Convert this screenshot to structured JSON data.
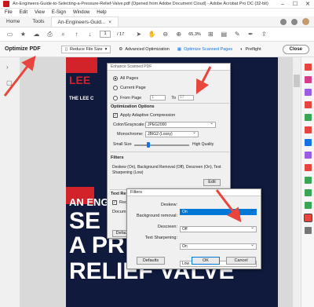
{
  "window": {
    "title": "An-Engineers-Guide-to-Selecting-a-Pressure-Relief-Valve.pdf (Opened from Adobe Document Cloud) - Adobe Acrobat Pro DC (32-bit)",
    "controls": [
      "–",
      "☐",
      "✕"
    ]
  },
  "menu": [
    "File",
    "Edit",
    "View",
    "E-Sign",
    "Window",
    "Help"
  ],
  "tabs": {
    "home": "Home",
    "tools": "Tools",
    "doc": "An-Engineers-Guid...",
    "doc_close": "×"
  },
  "toolbar": {
    "page_current": "1",
    "page_total": "/ 17",
    "zoom": "65.3%"
  },
  "optimize_bar": {
    "title": "Optimize PDF",
    "reduce": "Reduce File Size",
    "advanced": "Advanced Optimization",
    "enhance": "Optimize Scanned Pages",
    "preflight": "Preflight",
    "close": "Close"
  },
  "page_art": {
    "logo": "LEE",
    "tagline": "THE LEE C",
    "an_engineers": "AN ENGIN",
    "line1": "SE",
    "line2": "A PR",
    "line3": "RELIEF VALVE"
  },
  "enhance_dialog": {
    "title": "Enhance Scanned PDF",
    "all_pages": "All Pages",
    "current_page": "Current Page",
    "from_page": "From Page",
    "from_value": "1",
    "to_label": "To",
    "to_value": "17",
    "options_header": "Optimization Options",
    "adaptive": "Apply Adaptive Compression",
    "color_label": "Color/Grayscale:",
    "color_value": "JPEG2000",
    "mono_label": "Monochrome:",
    "mono_value": "JBIG2 (Lossy)",
    "small_size": "Small Size",
    "high_quality": "High Quality",
    "filters_header": "Filters",
    "filters_desc": "Deskew (On), Background Removal (Off), Descreen (On), Text Sharpening (Low)",
    "edit": "Edit",
    "text_rec_header": "Text Re",
    "rec_label": "Reco",
    "doc_label": "Docum",
    "defaults": "Defau"
  },
  "filters_dialog": {
    "title": "Filters",
    "deskew_label": "Deskew:",
    "deskew_value": "On",
    "bg_label": "Background removal:",
    "bg_value": "Off",
    "descreen_label": "Descreen:",
    "descreen_value": "On",
    "sharp_label": "Text Sharpening:",
    "sharp_value": "Low",
    "defaults": "Defaults",
    "ok": "OK",
    "cancel": "Cancel"
  },
  "colors": {
    "annotation_red": "#e8453c",
    "acrobat_red": "#c8161d",
    "link_blue": "#1473e6",
    "page_navy": "#0f1a3d",
    "selection_blue": "#0078d7"
  }
}
